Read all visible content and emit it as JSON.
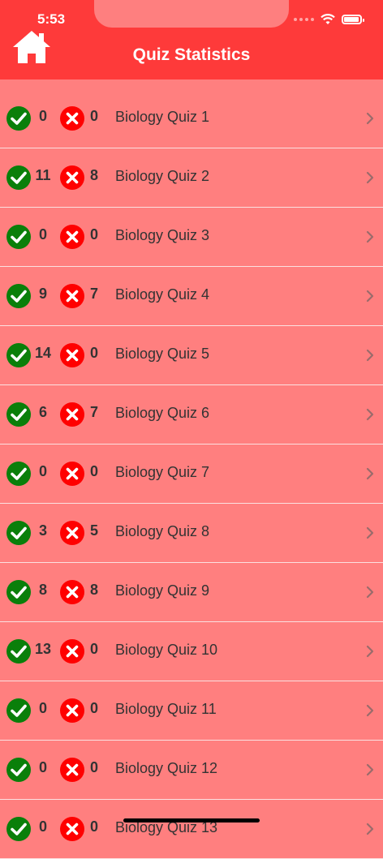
{
  "status_bar": {
    "time": "5:53"
  },
  "header": {
    "title": "Quiz Statistics",
    "home_icon": "home-icon"
  },
  "colors": {
    "header": "#fe3a3a",
    "background": "#ff7f7f",
    "correct": "#0a7f0a",
    "wrong": "#ff0000"
  },
  "rows": [
    {
      "correct": "0",
      "wrong": "0",
      "label": "Biology Quiz 1"
    },
    {
      "correct": "11",
      "wrong": "8",
      "label": "Biology Quiz 2"
    },
    {
      "correct": "0",
      "wrong": "0",
      "label": "Biology Quiz 3"
    },
    {
      "correct": "9",
      "wrong": "7",
      "label": "Biology Quiz 4"
    },
    {
      "correct": "14",
      "wrong": "0",
      "label": "Biology Quiz 5"
    },
    {
      "correct": "6",
      "wrong": "7",
      "label": "Biology Quiz 6"
    },
    {
      "correct": "0",
      "wrong": "0",
      "label": "Biology Quiz 7"
    },
    {
      "correct": "3",
      "wrong": "5",
      "label": "Biology Quiz 8"
    },
    {
      "correct": "8",
      "wrong": "8",
      "label": "Biology Quiz 9"
    },
    {
      "correct": "13",
      "wrong": "0",
      "label": "Biology Quiz 10"
    },
    {
      "correct": "0",
      "wrong": "0",
      "label": "Biology Quiz 11"
    },
    {
      "correct": "0",
      "wrong": "0",
      "label": "Biology Quiz 12"
    },
    {
      "correct": "0",
      "wrong": "0",
      "label": "Biology Quiz 13"
    }
  ]
}
